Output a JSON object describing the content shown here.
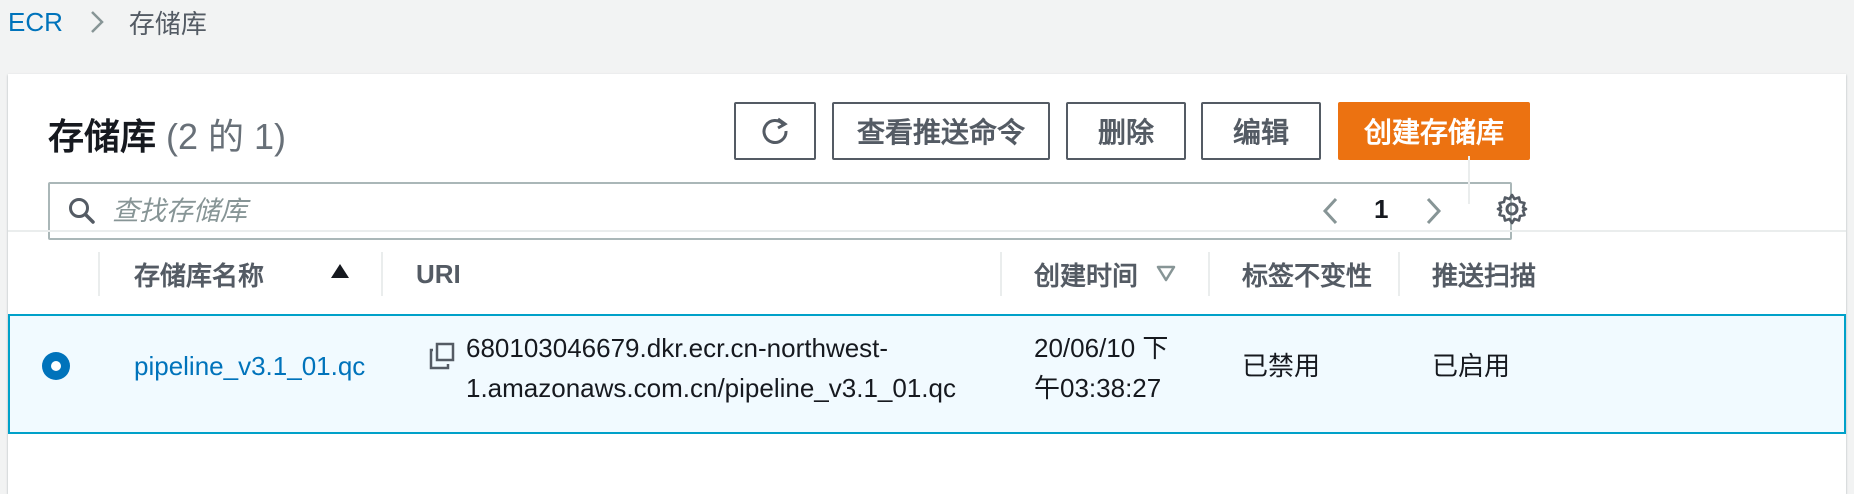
{
  "breadcrumb": {
    "root": "ECR",
    "current": "存储库"
  },
  "header": {
    "title": "存储库",
    "count": "(2 的 1)"
  },
  "toolbar": {
    "refresh_icon": "refresh-icon",
    "view_push_commands": "查看推送命令",
    "delete": "删除",
    "edit": "编辑",
    "create": "创建存储库"
  },
  "search": {
    "placeholder": "查找存储库",
    "value": ""
  },
  "pagination": {
    "page": "1"
  },
  "table": {
    "columns": {
      "name": "存储库名称",
      "uri": "URI",
      "created": "创建时间",
      "tag_immutability": "标签不变性",
      "scan_on_push": "推送扫描"
    },
    "rows": [
      {
        "name": "pipeline_v3.1_01.qc",
        "uri_line1": "680103046679.dkr.ecr.cn-northwest-",
        "uri_line2": "1.amazonaws.com.cn/pipeline_v3.1_01.qc",
        "created_line1": "20/06/10 下",
        "created_line2": "午03:38:27",
        "tag_immutability": "已禁用",
        "scan_on_push": "已启用",
        "selected": true
      }
    ]
  },
  "colors": {
    "primary": "#ec7211",
    "link": "#0073bb",
    "selected_row_bg": "#f1faff",
    "selected_row_border": "#00a1c9"
  }
}
